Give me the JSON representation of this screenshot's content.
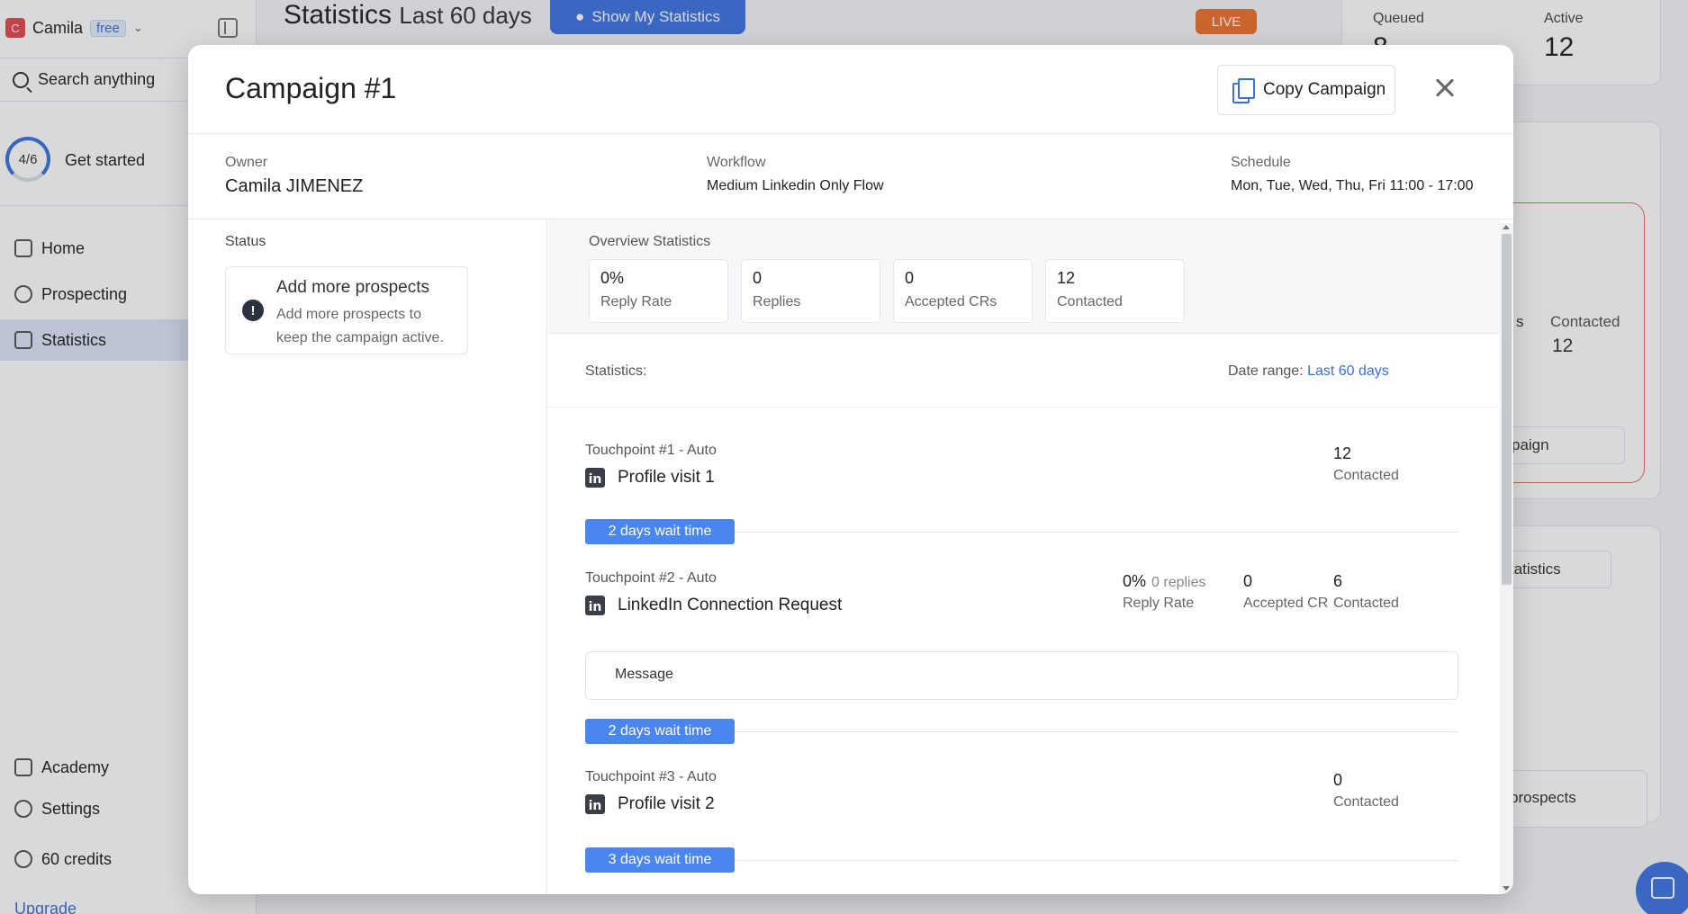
{
  "colors": {
    "accent": "#3d74e0",
    "wait_pill": "#4a86f0",
    "live": "#f0722e",
    "sidebar_active": "#dde6f8"
  },
  "sidebar": {
    "user_initial": "C",
    "user_name": "Camila",
    "plan": "free",
    "search_label": "Search anything",
    "progress": "4/6",
    "get_started": "Get started",
    "items": [
      {
        "label": "Home",
        "icon": "home-icon"
      },
      {
        "label": "Prospecting",
        "icon": "user-search-icon"
      },
      {
        "label": "Statistics",
        "icon": "bar-chart-icon"
      }
    ],
    "bottom": [
      {
        "label": "Academy",
        "icon": "graduation-cap-icon"
      },
      {
        "label": "Settings",
        "icon": "gear-icon"
      },
      {
        "label": "60 credits",
        "icon": "coins-icon"
      }
    ],
    "upgrade": "Upgrade"
  },
  "background": {
    "title": "Statistics",
    "title_range": "Last 60 days",
    "show_my_stats": "Show My Statistics",
    "live": "LIVE",
    "queued_label": "Queued",
    "queued_value": "8",
    "active_label": "Active",
    "active_value": "12",
    "contacted_label": "Contacted",
    "contacted_value": "12",
    "s_fragment": "s",
    "campaign_fragment": "paign",
    "statistics_fragment": "tatistics",
    "prospects_fragment": "prospects"
  },
  "modal": {
    "title": "Campaign #1",
    "copy_button": "Copy Campaign",
    "owner_label": "Owner",
    "owner_value": "Camila JIMENEZ",
    "workflow_label": "Workflow",
    "workflow_value": "Medium Linkedin Only Flow",
    "schedule_label": "Schedule",
    "schedule_value": "Mon, Tue, Wed, Thu, Fri 11:00 - 17:00",
    "status_label": "Status",
    "status_title": "Add more prospects",
    "status_desc": "Add more prospects to keep the campaign active."
  },
  "overview": {
    "label": "Overview Statistics",
    "cards": [
      {
        "value": "0%",
        "label": "Reply Rate"
      },
      {
        "value": "0",
        "label": "Replies"
      },
      {
        "value": "0",
        "label": "Accepted CRs"
      },
      {
        "value": "12",
        "label": "Contacted"
      }
    ]
  },
  "stats": {
    "label": "Statistics:",
    "date_range_label": "Date range:",
    "date_range_value": "Last 60 days"
  },
  "touchpoints": [
    {
      "name": "Touchpoint #1 - Auto",
      "step": "Profile visit 1",
      "contacted": "12",
      "contacted_label": "Contacted",
      "wait": "2 days wait time"
    },
    {
      "name": "Touchpoint #2 - Auto",
      "step": "LinkedIn Connection Request",
      "reply_rate": "0%",
      "replies": "0 replies",
      "reply_rate_label": "Reply Rate",
      "accepted": "0",
      "accepted_label": "Accepted CR",
      "contacted": "6",
      "contacted_label": "Contacted",
      "message_label": "Message",
      "wait": "2 days wait time"
    },
    {
      "name": "Touchpoint #3 - Auto",
      "step": "Profile visit 2",
      "contacted": "0",
      "contacted_label": "Contacted",
      "wait": "3 days wait time"
    }
  ]
}
